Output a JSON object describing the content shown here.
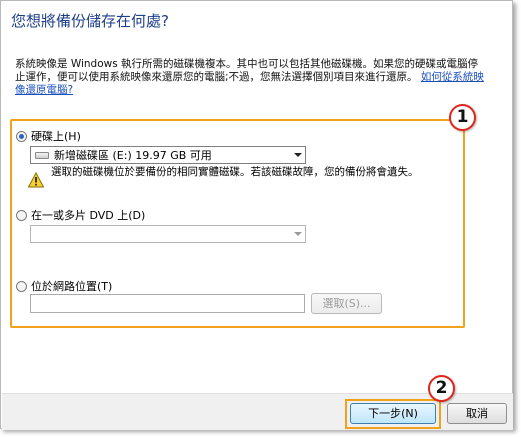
{
  "header": {
    "title": "您想將備份儲存在何處?"
  },
  "description": {
    "text": "系統映像是 Windows 執行所需的磁碟機複本。其中也可以包括其他磁碟機。如果您的硬碟或電腦停止運作，便可以使用系統映像來還原您的電腦;不過，您無法選擇個別項目來進行還原。",
    "link": "如何從系統映像還原電腦?"
  },
  "options": {
    "hard_disk": {
      "label": "硬碟上(H)",
      "selected": true,
      "drive_value": "新增磁碟區 (E:)  19.97 GB 可用",
      "warning": "選取的磁碟機位於要備份的相同實體磁碟。若該磁碟故障，您的備份將會遺失。"
    },
    "dvd": {
      "label": "在一或多片 DVD 上(D)",
      "selected": false,
      "drive_value": ""
    },
    "network": {
      "label": "位於網路位置(T)",
      "selected": false,
      "path_value": "",
      "browse_label": "選取(S)..."
    }
  },
  "callouts": {
    "options_number": "1",
    "next_number": "2"
  },
  "footer": {
    "next_label": "下一步(N)",
    "cancel_label": "取消"
  },
  "colors": {
    "title": "#1e3f8a",
    "link": "#1a4fbf",
    "callout_border": "#f2a21a",
    "badge_border": "#e0261b"
  },
  "icons": {
    "warning": "warning-triangle-icon",
    "drive": "hard-drive-icon",
    "dropdown": "chevron-down-icon"
  }
}
